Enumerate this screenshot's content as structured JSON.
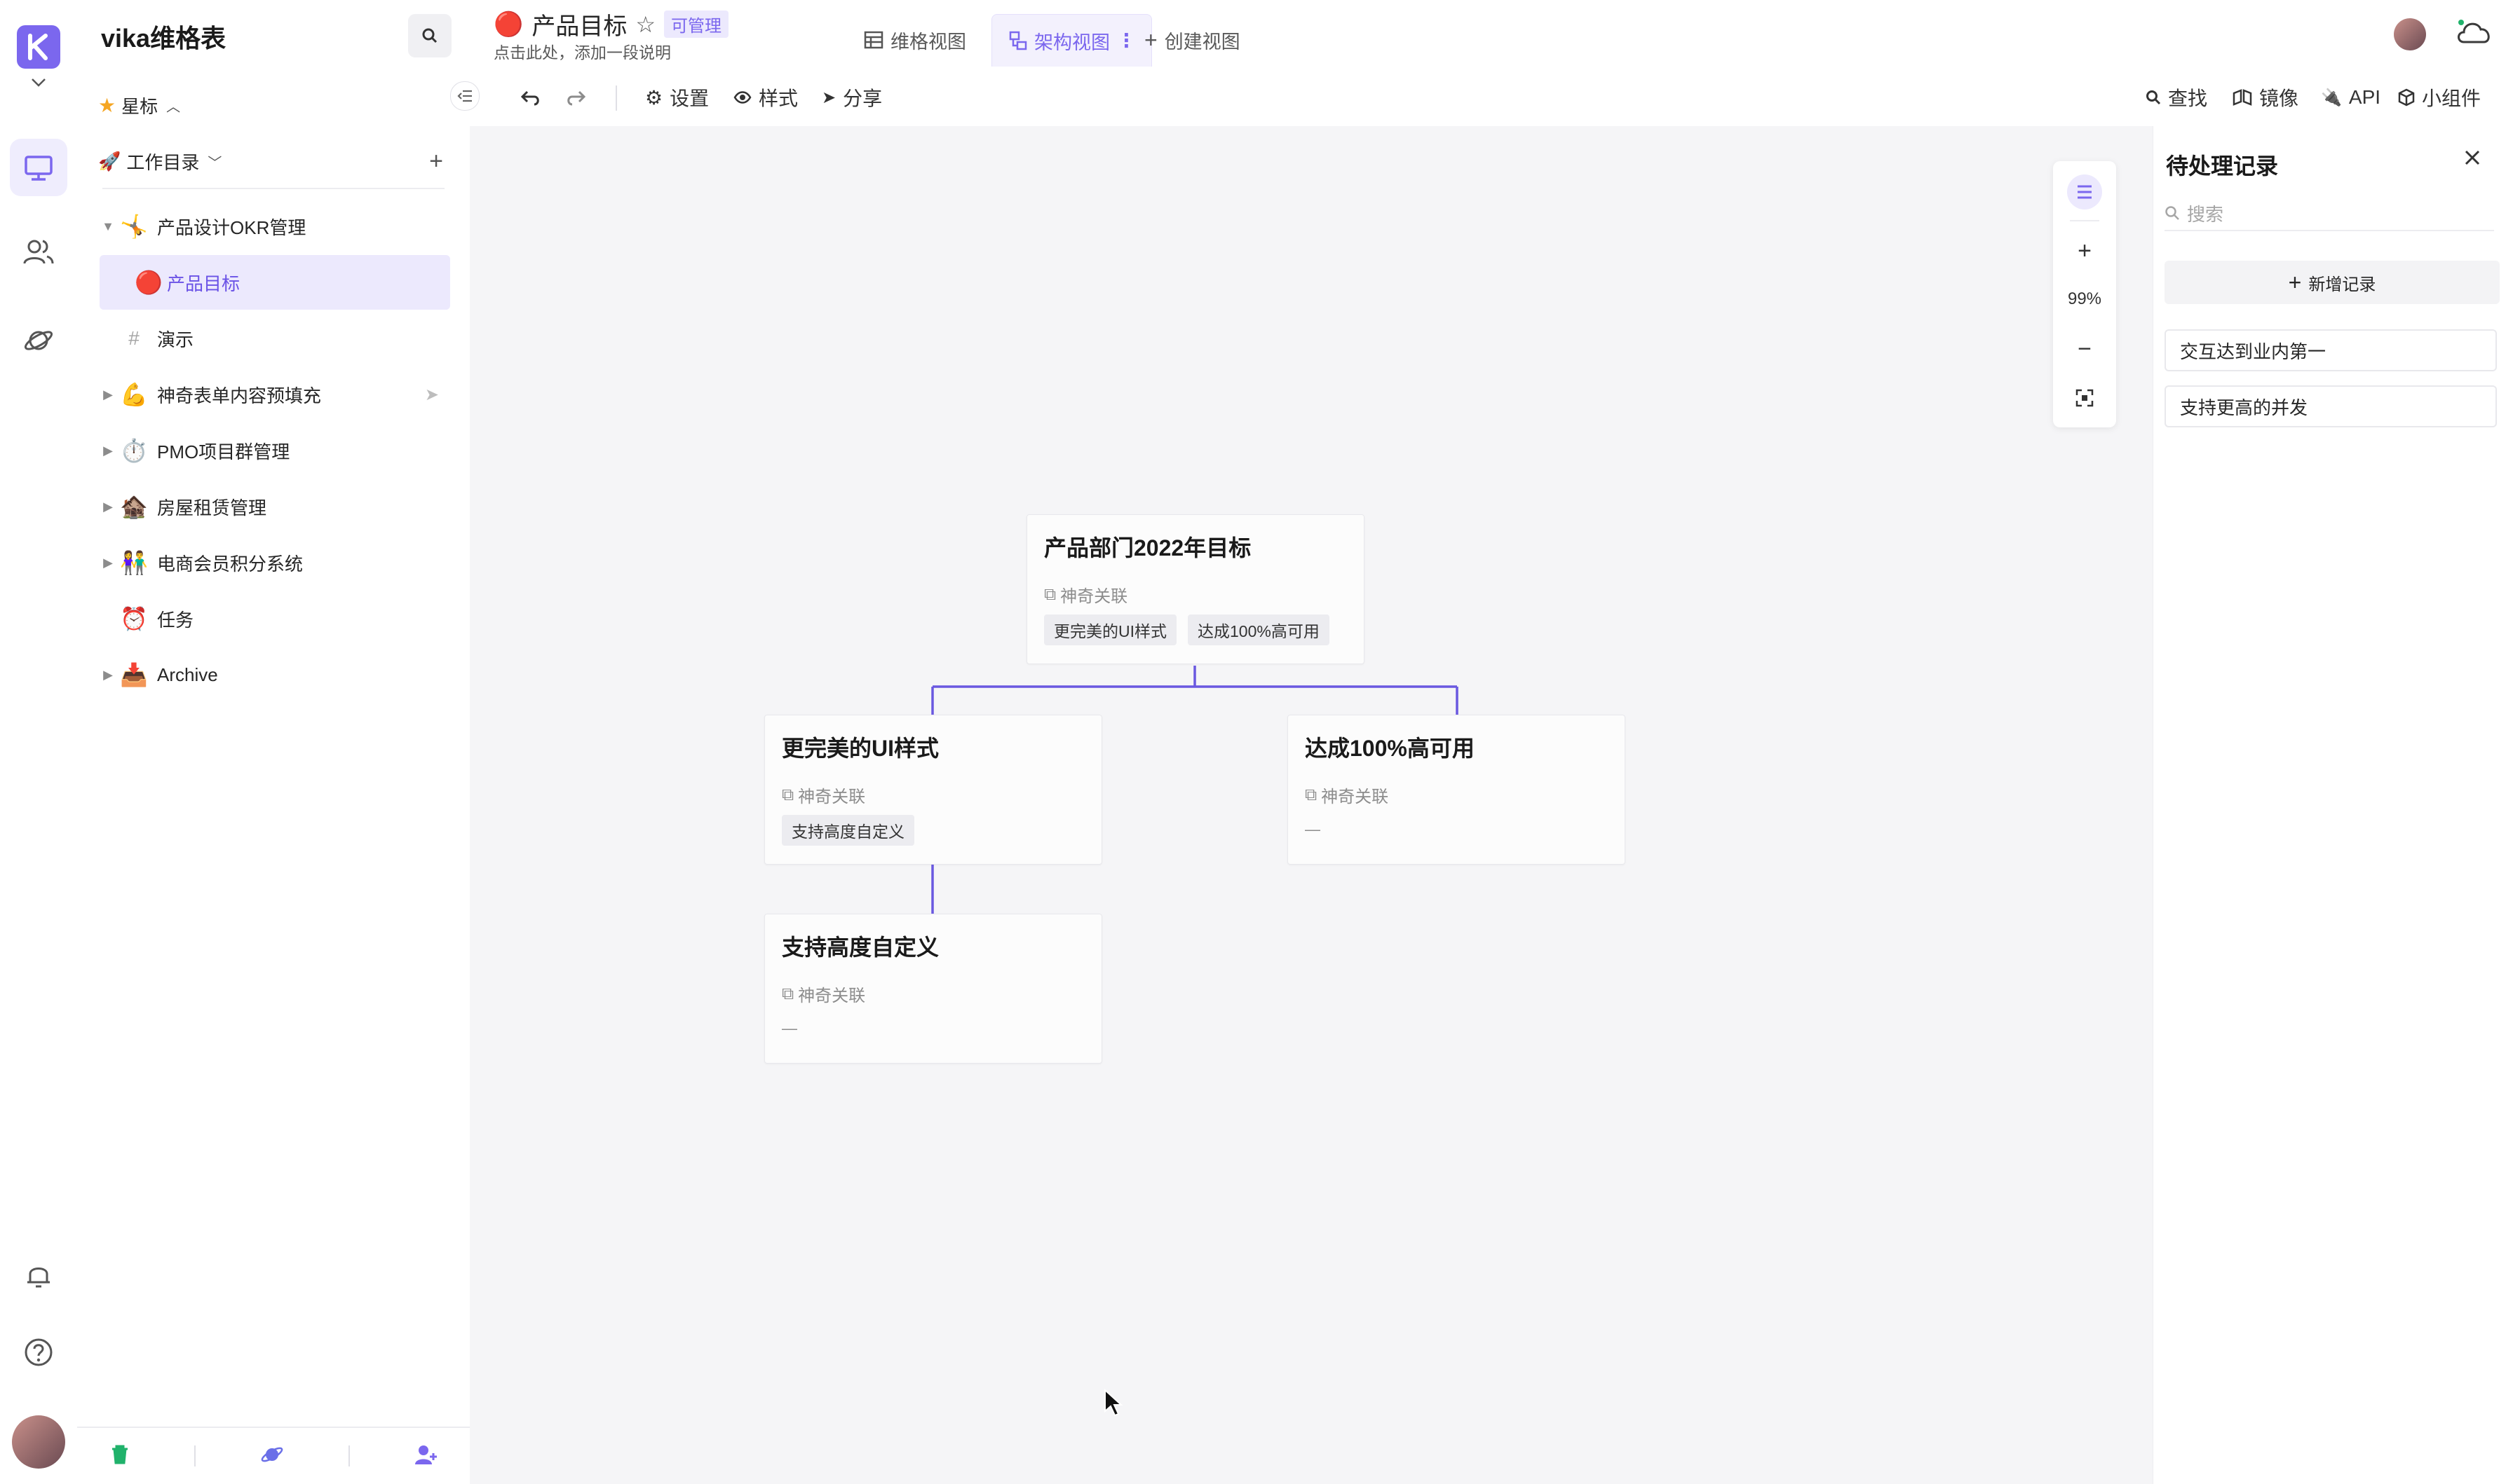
{
  "app": {
    "workspace_name": "vika维格表",
    "accent_color": "#7b67ee",
    "connector_color": "#6a58e0"
  },
  "sidebar": {
    "starred_label": "星标",
    "catalog_label": "工作目录",
    "items": [
      {
        "emoji": "🤸",
        "label": "产品设计OKR管理",
        "caret": "▼"
      },
      {
        "emoji": "🔴",
        "label": "产品目标",
        "caret": ""
      },
      {
        "emoji": "#",
        "label": "演示",
        "caret": ""
      },
      {
        "emoji": "💪",
        "label": "神奇表单内容预填充",
        "caret": "▶"
      },
      {
        "emoji": "⏱️",
        "label": "PMO项目群管理",
        "caret": "▶"
      },
      {
        "emoji": "🏚️",
        "label": "房屋租赁管理",
        "caret": "▶"
      },
      {
        "emoji": "👫",
        "label": "电商会员积分系统",
        "caret": "▶"
      },
      {
        "emoji": "⏰",
        "label": "任务",
        "caret": ""
      },
      {
        "emoji": "📥",
        "label": "Archive",
        "caret": "▶"
      }
    ]
  },
  "header": {
    "node_emoji": "🔴",
    "node_title": "产品目标",
    "permission_badge": "可管理",
    "description_placeholder": "点击此处，添加一段说明",
    "tabs": {
      "grid": "维格视图",
      "architecture": "架构视图",
      "create": "创建视图"
    }
  },
  "toolbar": {
    "settings": "设置",
    "style": "样式",
    "share": "分享",
    "find": "查找",
    "mirror": "镜像",
    "api": "API",
    "widgets": "小组件"
  },
  "canvas": {
    "zoom": "99%",
    "cards": [
      {
        "title": "产品部门2022年目标",
        "field_label": "神奇关联",
        "tags": [
          "更完美的UI样式",
          "达成100%高可用"
        ],
        "empty": ""
      },
      {
        "title": "更完美的UI样式",
        "field_label": "神奇关联",
        "tags": [
          "支持高度自定义"
        ],
        "empty": ""
      },
      {
        "title": "达成100%高可用",
        "field_label": "神奇关联",
        "tags": [],
        "empty": "—"
      },
      {
        "title": "支持高度自定义",
        "field_label": "神奇关联",
        "tags": [],
        "empty": "—"
      }
    ]
  },
  "pending": {
    "title": "待处理记录",
    "search_placeholder": "搜索",
    "add_label": "新增记录",
    "records": [
      "交互达到业内第一",
      "支持更高的并发"
    ]
  }
}
